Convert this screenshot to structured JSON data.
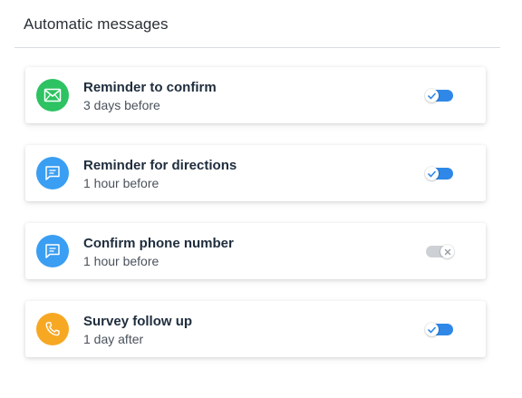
{
  "header": {
    "title": "Automatic messages"
  },
  "colors": {
    "green": "#2dc262",
    "blue": "#3a9ef3",
    "orange": "#f7a823",
    "toggle_on": "#2f88e8",
    "toggle_off": "#cdd0d4"
  },
  "messages": [
    {
      "title": "Reminder to confirm",
      "subtitle": "3 days before",
      "icon": "envelope-icon",
      "icon_color": "#2dc262",
      "enabled": true
    },
    {
      "title": "Reminder for directions",
      "subtitle": "1 hour before",
      "icon": "chat-bubble-icon",
      "icon_color": "#3a9ef3",
      "enabled": true
    },
    {
      "title": "Confirm phone number",
      "subtitle": "1 hour before",
      "icon": "chat-bubble-icon",
      "icon_color": "#3a9ef3",
      "enabled": false
    },
    {
      "title": "Survey follow up",
      "subtitle": "1 day after",
      "icon": "phone-icon",
      "icon_color": "#f7a823",
      "enabled": true
    }
  ]
}
